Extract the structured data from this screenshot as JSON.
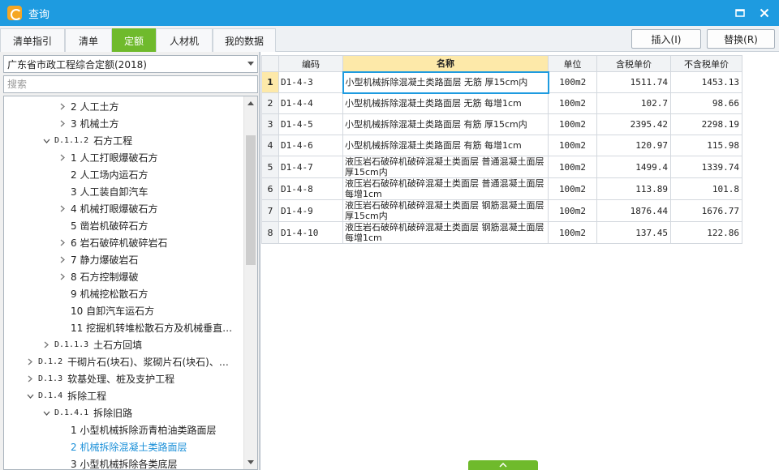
{
  "window": {
    "title": "查询"
  },
  "tabs": [
    {
      "label": "清单指引",
      "active": false
    },
    {
      "label": "清单",
      "active": false
    },
    {
      "label": "定额",
      "active": true
    },
    {
      "label": "人材机",
      "active": false
    },
    {
      "label": "我的数据",
      "active": false
    }
  ],
  "toolbar": {
    "insert_label": "插入(I)",
    "replace_label": "替换(R)"
  },
  "left": {
    "dropdown_value": "广东省市政工程综合定额(2018)",
    "search_placeholder": "搜索"
  },
  "tree": [
    {
      "code": "",
      "label": "2 人工土方",
      "indent": 2,
      "toggle": "right",
      "selected": false
    },
    {
      "code": "",
      "label": "3 机械土方",
      "indent": 2,
      "toggle": "right",
      "selected": false
    },
    {
      "code": "D.1.1.2",
      "label": "石方工程",
      "indent": 1,
      "toggle": "down",
      "selected": false
    },
    {
      "code": "",
      "label": "1 人工打眼爆破石方",
      "indent": 2,
      "toggle": "right",
      "selected": false
    },
    {
      "code": "",
      "label": "2 人工场内运石方",
      "indent": 2,
      "toggle": "none",
      "selected": false
    },
    {
      "code": "",
      "label": "3 人工装自卸汽车",
      "indent": 2,
      "toggle": "none",
      "selected": false
    },
    {
      "code": "",
      "label": "4 机械打眼爆破石方",
      "indent": 2,
      "toggle": "right",
      "selected": false
    },
    {
      "code": "",
      "label": "5 凿岩机破碎石方",
      "indent": 2,
      "toggle": "none",
      "selected": false
    },
    {
      "code": "",
      "label": "6 岩石破碎机破碎岩石",
      "indent": 2,
      "toggle": "right",
      "selected": false
    },
    {
      "code": "",
      "label": "7 静力爆破岩石",
      "indent": 2,
      "toggle": "right",
      "selected": false
    },
    {
      "code": "",
      "label": "8 石方控制爆破",
      "indent": 2,
      "toggle": "right",
      "selected": false
    },
    {
      "code": "",
      "label": "9 机械挖松散石方",
      "indent": 2,
      "toggle": "none",
      "selected": false
    },
    {
      "code": "",
      "label": "10 自卸汽车运石方",
      "indent": 2,
      "toggle": "none",
      "selected": false
    },
    {
      "code": "",
      "label": "11 挖掘机转堆松散石方及机械垂直…",
      "indent": 2,
      "toggle": "none",
      "selected": false
    },
    {
      "code": "D.1.1.3",
      "label": "土石方回填",
      "indent": 1,
      "toggle": "right",
      "selected": false
    },
    {
      "code": "D.1.2",
      "label": "干砌片石(块石)、浆砌片石(块石)、…",
      "indent": 0,
      "toggle": "right",
      "selected": false
    },
    {
      "code": "D.1.3",
      "label": "软基处理、桩及支护工程",
      "indent": 0,
      "toggle": "right",
      "selected": false
    },
    {
      "code": "D.1.4",
      "label": "拆除工程",
      "indent": 0,
      "toggle": "down",
      "selected": false
    },
    {
      "code": "D.1.4.1",
      "label": "拆除旧路",
      "indent": 1,
      "toggle": "down",
      "selected": false
    },
    {
      "code": "",
      "label": "1 小型机械拆除沥青柏油类路面层",
      "indent": 2,
      "toggle": "none",
      "selected": false
    },
    {
      "code": "",
      "label": "2 机械拆除混凝土类路面层",
      "indent": 2,
      "toggle": "none",
      "selected": true
    },
    {
      "code": "",
      "label": "3 小型机械拆除各类底层",
      "indent": 2,
      "toggle": "none",
      "selected": false
    }
  ],
  "grid": {
    "headers": [
      "",
      "编码",
      "名称",
      "单位",
      "含税单价",
      "不含税单价"
    ],
    "rows": [
      {
        "idx": "1",
        "code": "D1-4-3",
        "name": "小型机械拆除混凝土类路面层 无筋 厚15cm内",
        "unit": "100m2",
        "price_tax": "1511.74",
        "price_notax": "1453.13"
      },
      {
        "idx": "2",
        "code": "D1-4-4",
        "name": "小型机械拆除混凝土类路面层 无筋 每增1cm",
        "unit": "100m2",
        "price_tax": "102.7",
        "price_notax": "98.66"
      },
      {
        "idx": "3",
        "code": "D1-4-5",
        "name": "小型机械拆除混凝土类路面层 有筋 厚15cm内",
        "unit": "100m2",
        "price_tax": "2395.42",
        "price_notax": "2298.19"
      },
      {
        "idx": "4",
        "code": "D1-4-6",
        "name": "小型机械拆除混凝土类路面层 有筋 每增1cm",
        "unit": "100m2",
        "price_tax": "120.97",
        "price_notax": "115.98"
      },
      {
        "idx": "5",
        "code": "D1-4-7",
        "name": "液压岩石破碎机破碎混凝土类面层 普通混凝土面层 厚15cm内",
        "unit": "100m2",
        "price_tax": "1499.4",
        "price_notax": "1339.74"
      },
      {
        "idx": "6",
        "code": "D1-4-8",
        "name": "液压岩石破碎机破碎混凝土类面层 普通混凝土面层 每增1cm",
        "unit": "100m2",
        "price_tax": "113.89",
        "price_notax": "101.8"
      },
      {
        "idx": "7",
        "code": "D1-4-9",
        "name": "液压岩石破碎机破碎混凝土类面层 钢筋混凝土面层 厚15cm内",
        "unit": "100m2",
        "price_tax": "1876.44",
        "price_notax": "1676.77"
      },
      {
        "idx": "8",
        "code": "D1-4-10",
        "name": "液压岩石破碎机破碎混凝土类面层 钢筋混凝土面层 每增1cm",
        "unit": "100m2",
        "price_tax": "137.45",
        "price_notax": "122.86"
      }
    ]
  },
  "icons": {
    "app": "app-logo-icon",
    "maximize": "maximize-icon",
    "close": "close-icon",
    "dropdown": "chevron-down-icon",
    "expand": "chevron-right-icon",
    "collapse": "chevron-down-icon",
    "splitter": "chevron-up-icon"
  },
  "colors": {
    "titlebar": "#1e9be0",
    "active_tab": "#6fba2c",
    "selected_text": "#1a8fd8",
    "name_header": "#fde9a9"
  }
}
